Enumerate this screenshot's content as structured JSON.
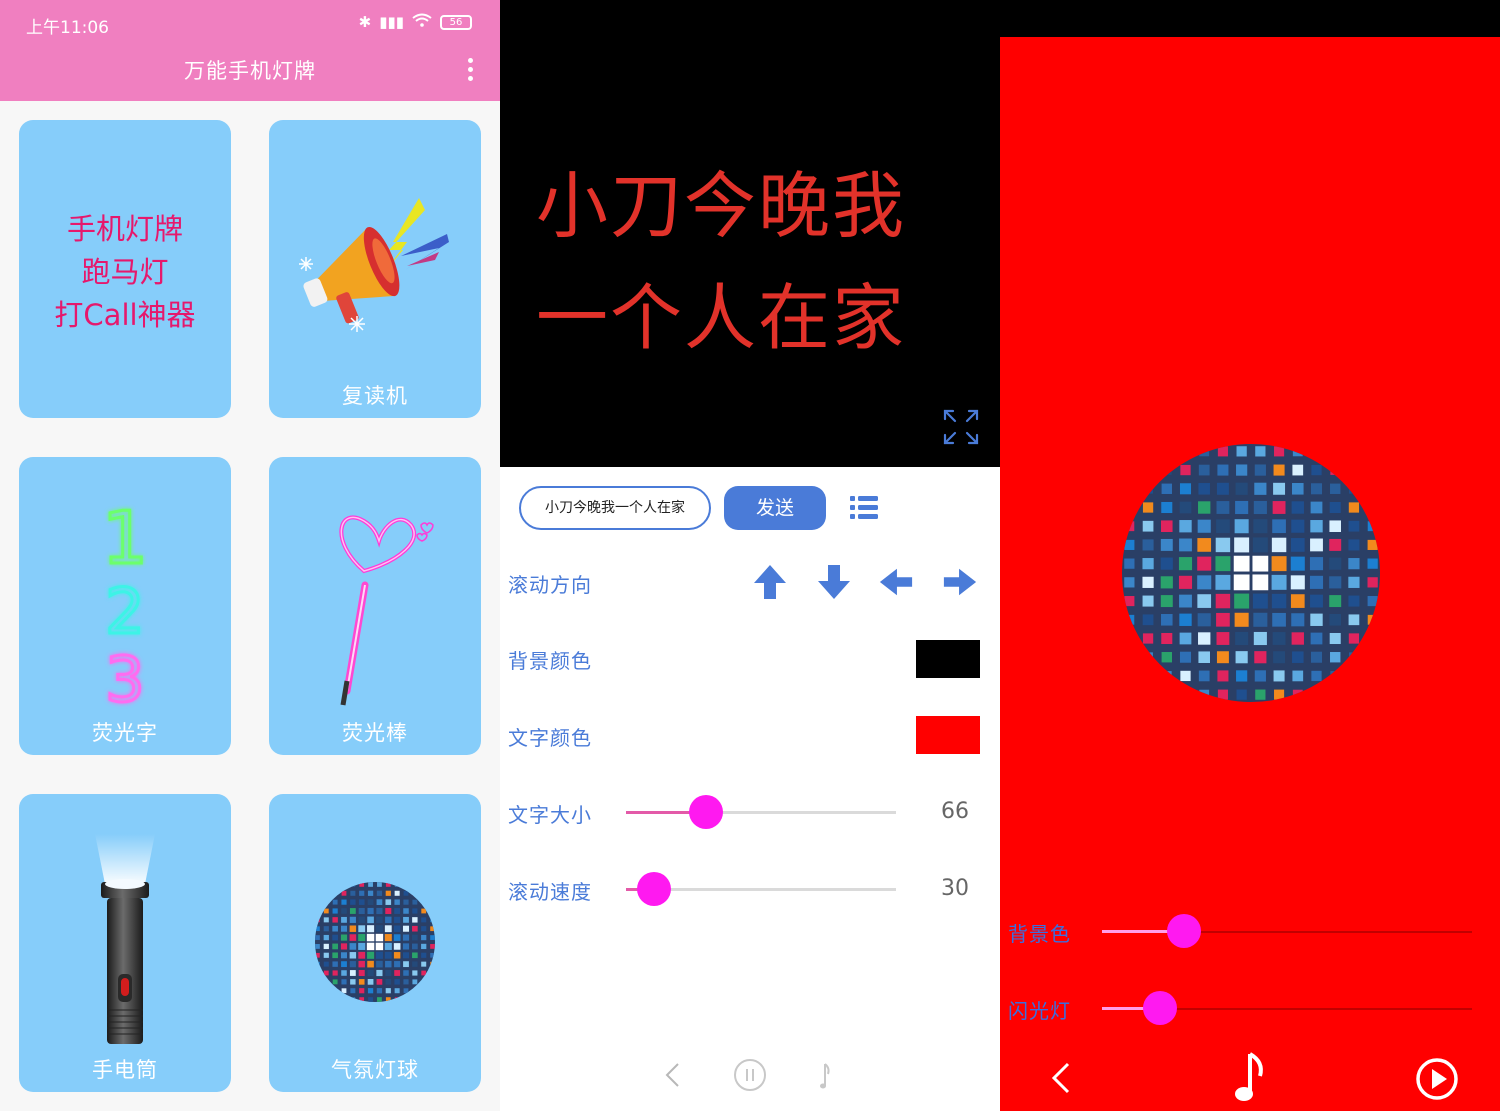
{
  "status_bar": {
    "time": "上午11:06",
    "battery": "56"
  },
  "app_bar": {
    "title": "万能手机灯牌"
  },
  "home_cards": [
    {
      "label": "",
      "lines": [
        "手机灯牌",
        "跑马灯",
        "打Call神器"
      ],
      "icon": "marquee-text"
    },
    {
      "label": "复读机",
      "icon": "megaphone-icon"
    },
    {
      "label": "荧光字",
      "icon": "neon-numbers-icon",
      "digits": [
        "1",
        "2",
        "3"
      ]
    },
    {
      "label": "荧光棒",
      "icon": "glow-stick-icon"
    },
    {
      "label": "手电筒",
      "icon": "flashlight-icon"
    },
    {
      "label": "气氛灯球",
      "icon": "disco-ball-icon"
    }
  ],
  "editor": {
    "preview_text_line1": "小刀今晚我",
    "preview_text_line2": "一个人在家",
    "input_value": "小刀今晚我一个人在家",
    "send_label": "发送",
    "scroll_direction_label": "滚动方向",
    "bg_color_label": "背景颜色",
    "text_color_label": "文字颜色",
    "text_size_label": "文字大小",
    "scroll_speed_label": "滚动速度",
    "text_size_value": "66",
    "scroll_speed_value": "30",
    "bg_color": "#000000",
    "text_color": "#ff0000"
  },
  "disco": {
    "bg_color_label": "背景色",
    "flash_label": "闪光灯",
    "panel_color": "#ff0000",
    "slider_color": "#ff19f0"
  }
}
